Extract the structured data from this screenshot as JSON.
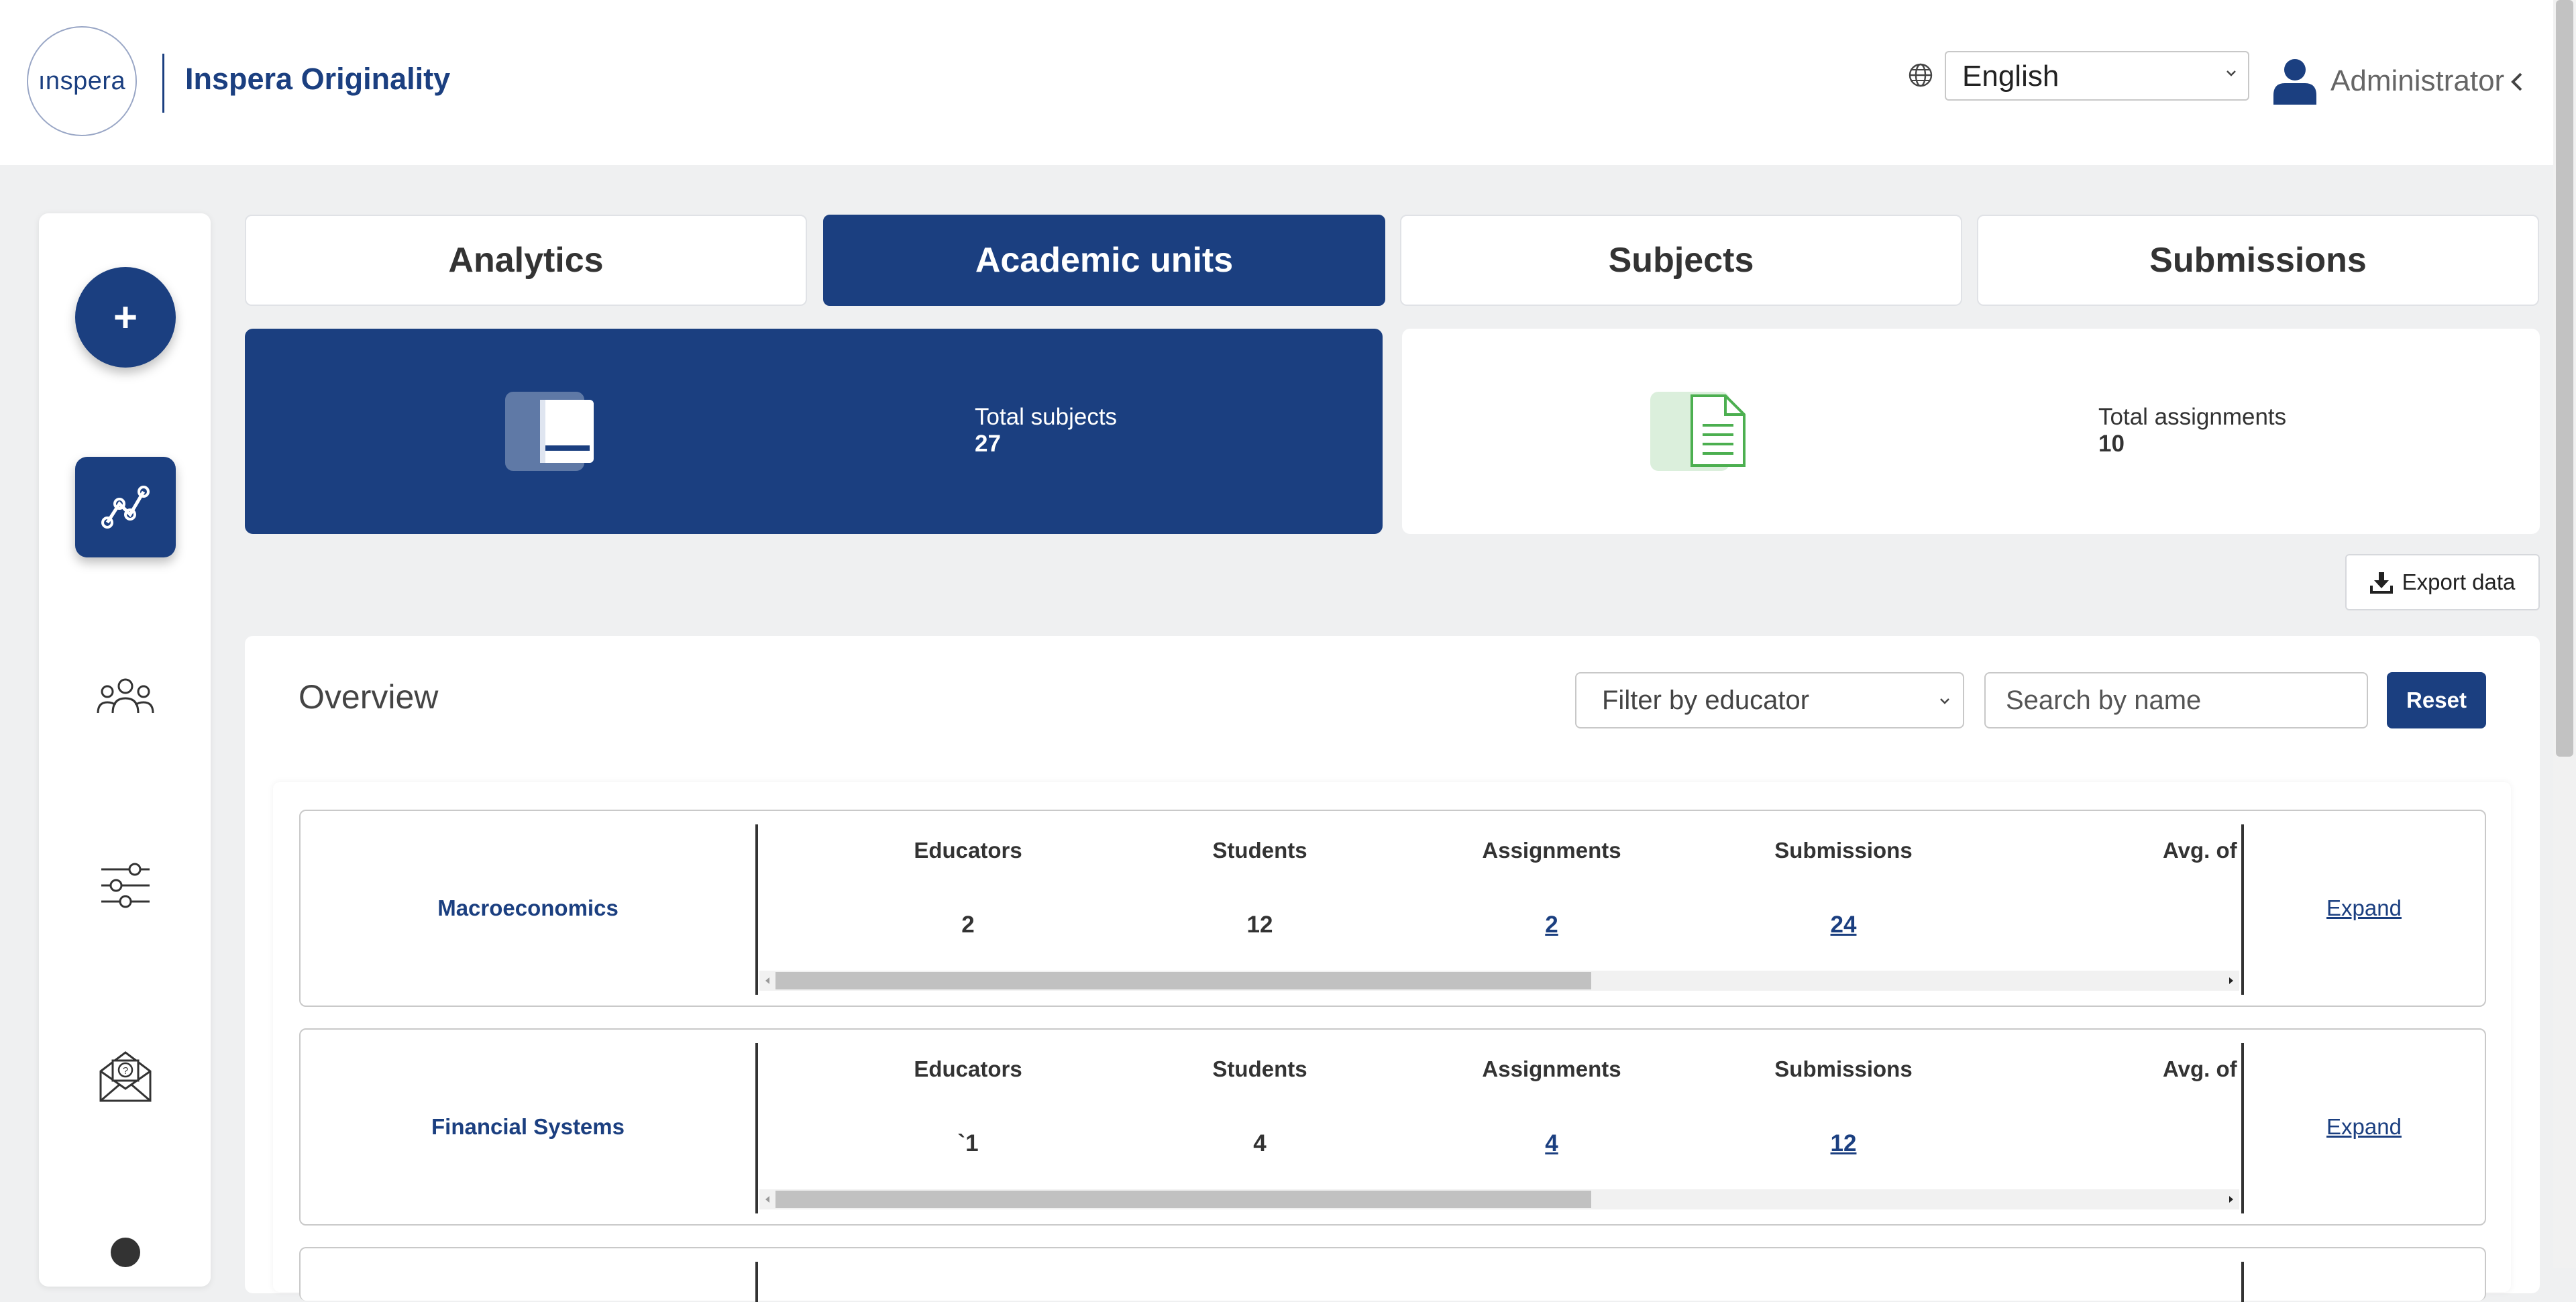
{
  "header": {
    "logo_text": "ınspera",
    "brand_name": "Inspera Originality",
    "language": "English",
    "user_label": "Administrator"
  },
  "sidebar": {
    "add_label": "+",
    "items": [
      {
        "icon": "analytics-chart-icon",
        "active": true
      },
      {
        "icon": "users-group-icon",
        "active": false
      },
      {
        "icon": "sliders-settings-icon",
        "active": false
      },
      {
        "icon": "help-envelope-icon",
        "active": false
      },
      {
        "icon": "person-icon",
        "active": false
      }
    ]
  },
  "tabs": [
    {
      "label": "Analytics",
      "active": false
    },
    {
      "label": "Academic units",
      "active": true
    },
    {
      "label": "Subjects",
      "active": false
    },
    {
      "label": "Submissions",
      "active": false
    }
  ],
  "stats": {
    "subjects": {
      "label": "Total subjects",
      "value": "27"
    },
    "assignments": {
      "label": "Total assignments",
      "value": "10"
    }
  },
  "export_label": "Export data",
  "overview": {
    "title": "Overview",
    "filter_placeholder": "Filter by educator",
    "search_placeholder": "Search by name",
    "reset_label": "Reset"
  },
  "columns": {
    "educators": "Educators",
    "students": "Students",
    "assignments": "Assignments",
    "submissions": "Submissions",
    "avg": "Avg. of"
  },
  "units": [
    {
      "name": "Macroeconomics",
      "educators": "2",
      "students": "12",
      "assignments": "2",
      "submissions": "24",
      "expand": "Expand"
    },
    {
      "name": "Financial Systems",
      "educators": "`1",
      "students": "4",
      "assignments": "4",
      "submissions": "12",
      "expand": "Expand"
    }
  ],
  "colors": {
    "primary": "#1b3f80",
    "background": "#eff0f1",
    "green_icon": "#4caf50"
  }
}
